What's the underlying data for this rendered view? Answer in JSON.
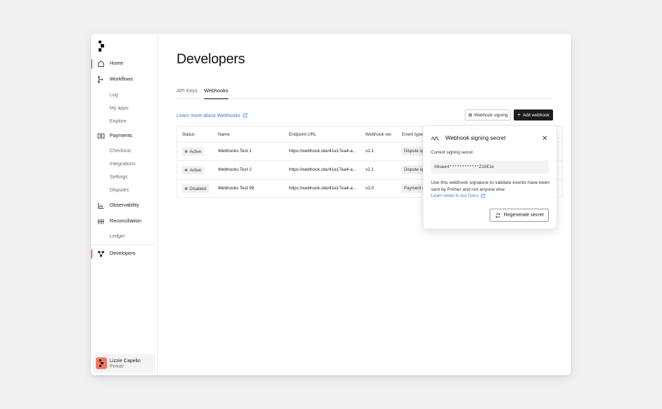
{
  "sidebar": {
    "items": [
      {
        "label": "Home",
        "icon": "home-icon"
      },
      {
        "label": "Workflows",
        "icon": "workflows-icon"
      },
      {
        "label": "Log"
      },
      {
        "label": "My apps"
      },
      {
        "label": "Explore"
      },
      {
        "label": "Payments",
        "icon": "payments-icon"
      },
      {
        "label": "Checkout"
      },
      {
        "label": "Integrations"
      },
      {
        "label": "Settings"
      },
      {
        "label": "Disputes"
      },
      {
        "label": "Observability",
        "icon": "chart-icon"
      },
      {
        "label": "Reconciliation",
        "icon": "reconciliation-icon"
      },
      {
        "label": "Ledger"
      },
      {
        "label": "Developers",
        "icon": "developers-icon"
      }
    ],
    "user": {
      "name": "Lizzie Capelin",
      "org": "Primer"
    }
  },
  "main": {
    "title": "Developers",
    "tabs": [
      "API Keys",
      "Webhooks"
    ],
    "learn_more": "Learn more about Webhooks",
    "webhook_signing_button": "Webhook signing",
    "add_webhook_button": "Add webhook",
    "table": {
      "headers": [
        "Status",
        "Name",
        "Endpoint URL",
        "Webhook ver.",
        "Event types"
      ],
      "rows": [
        {
          "status": "Active",
          "name": "Webhooks Test 1",
          "url": "https://webhook.site/41e17ea4-a...",
          "version": "v2.1",
          "event": "Dispute op"
        },
        {
          "status": "Active",
          "name": "Webhooks Test 2",
          "url": "https://webhook.site/41e17ea4-a...",
          "version": "v2.1",
          "event": "Dispute op"
        },
        {
          "status": "Disabled",
          "name": "Webhooks Test 99",
          "url": "https://webhook.site/41e17ea4-a...",
          "version": "v2.0",
          "event": "Payment c"
        }
      ]
    }
  },
  "popover": {
    "title": "Webhook signing secret",
    "current_label": "Current signing secret",
    "secret": "G6uwe4************Z1GE1e",
    "description": "Use this webhook signature to validate events have been sent by Primer and not anyone else",
    "docs_link": "Learn more in our Docs",
    "regenerate_button": "Regenerate secret"
  },
  "colors": {
    "accent": "#f5765e",
    "link": "#3a7ad6",
    "dark_button": "#1d1d1d"
  }
}
